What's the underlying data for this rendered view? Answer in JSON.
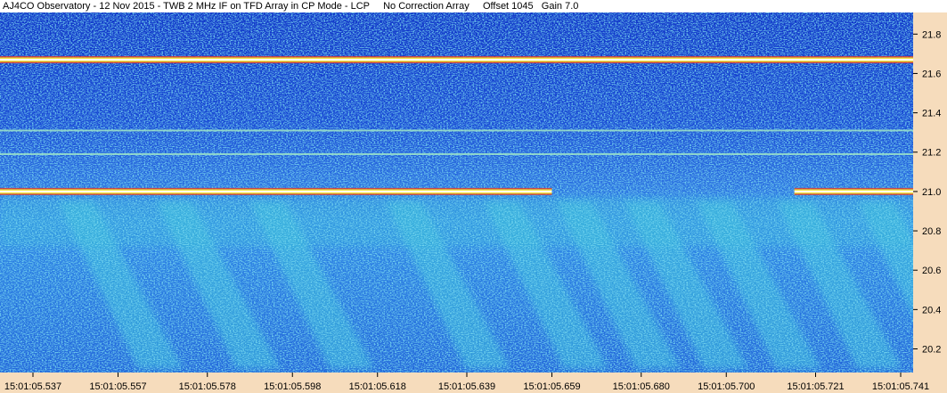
{
  "title": "AJ4CO Observatory - 12 Nov 2015 - TWB 2 MHz IF on TFD Array in CP Mode - LCP     No Correction Array     Offset 1045   Gain 7.0",
  "colors": {
    "background_low": "#1035c8",
    "background_mid": "#1f6fe0",
    "noise_high": "#3fd2d8",
    "emission_yellow": "#f2e23c",
    "emission_red": "#e23a2a",
    "emission_white": "#ffffff",
    "axis_panel": "#f6dcbc"
  },
  "chart_data": {
    "type": "heatmap",
    "title": "AJ4CO Observatory - 12 Nov 2015 - TWB 2 MHz IF on TFD Array in CP Mode - LCP     No Correction Array     Offset 1045   Gain 7.0",
    "xlabel": "",
    "ylabel": "",
    "x_tick_labels": [
      "15:01:05.537",
      "15:01:05.557",
      "15:01:05.578",
      "15:01:05.598",
      "15:01:05.618",
      "15:01:05.639",
      "15:01:05.659",
      "15:01:05.680",
      "15:01:05.700",
      "15:01:05.721",
      "15:01:05.741"
    ],
    "y_tick_labels": [
      "21.8",
      "21.6",
      "21.4",
      "21.2",
      "21.0",
      "20.8",
      "20.6",
      "20.4",
      "20.2"
    ],
    "y_ticks": [
      21.8,
      21.6,
      21.4,
      21.2,
      21.0,
      20.8,
      20.6,
      20.4,
      20.2
    ],
    "ylim": [
      20.08,
      21.91
    ],
    "xlim": [
      "15:01:05.537",
      "15:01:05.741"
    ],
    "features": [
      {
        "name": "interference-line",
        "freq": 21.67,
        "start": "15:01:05.537",
        "end": "15:01:05.741"
      },
      {
        "name": "interference-line",
        "freq": 21.0,
        "start": "15:01:05.537",
        "end": "15:01:05.659"
      },
      {
        "name": "interference-line",
        "freq": 21.0,
        "start": "15:01:05.716",
        "end": "15:01:05.741"
      },
      {
        "name": "weak-line",
        "freq": 21.31,
        "start": "15:01:05.537",
        "end": "15:01:05.741"
      },
      {
        "name": "weak-line",
        "freq": 21.19,
        "start": "15:01:05.537",
        "end": "15:01:05.741"
      }
    ],
    "s_bursts_approx_start_times": [
      "15:01:05.545",
      "15:01:05.568",
      "15:01:05.590",
      "15:01:05.622",
      "15:01:05.645",
      "15:01:05.662",
      "15:01:05.678",
      "15:01:05.695",
      "15:01:05.714",
      "15:01:05.733"
    ]
  }
}
